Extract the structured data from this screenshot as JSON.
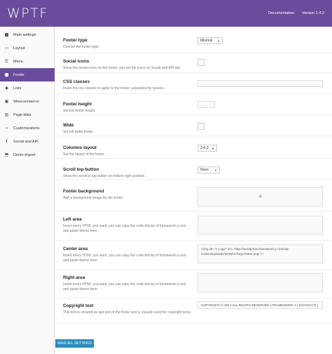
{
  "header": {
    "logo": "WPTF",
    "documentation": "Documentation",
    "version": "Version 1.4.2"
  },
  "sidebar": {
    "items": [
      {
        "label": "Main settings",
        "icon": "page-icon"
      },
      {
        "label": "Layout",
        "icon": "layout-icon"
      },
      {
        "label": "Menu",
        "icon": "menu-icon"
      },
      {
        "label": "Footer",
        "icon": "footer-icon",
        "active": true
      },
      {
        "label": "Lists",
        "icon": "tag-icon"
      },
      {
        "label": "Woocommerce",
        "icon": "cart-icon"
      },
      {
        "label": "Page titles",
        "icon": "titles-icon"
      },
      {
        "label": "Customizations",
        "icon": "code-icon"
      },
      {
        "label": "Social and API",
        "icon": "facebook-icon"
      },
      {
        "label": "Demo import",
        "icon": "import-icon"
      }
    ]
  },
  "settings": {
    "footer_type": {
      "label": "Footer type",
      "desc": "Choose the footer type.",
      "value": "Minimal"
    },
    "social_icons": {
      "label": "Social icons",
      "desc": "Show the social icons on the footer, you set the icons on Social and API tab."
    },
    "css_classes": {
      "label": "CSS classes",
      "desc": "Insert the css classes to apply to the footer, separated by spaces."
    },
    "footer_height": {
      "label": "Footer height",
      "desc": "Set the footer height."
    },
    "wide": {
      "label": "Wide",
      "desc": "Set full width footer."
    },
    "columns_layout": {
      "label": "Columns layout",
      "desc": "Set the layout of the footer.",
      "value": "3-6-3"
    },
    "scroll_top": {
      "label": "Scroll top button",
      "desc": "Show the scroll to top button on bottom right position.",
      "value": "None"
    },
    "footer_background": {
      "label": "Footer background",
      "desc": "Add a background image for the footer.",
      "plus": "+"
    },
    "left_area": {
      "label": "Left area",
      "desc": "Insert every HTML you want, you can copy the code blocks of framework-y.com and paste theme here."
    },
    "center_area": {
      "label": "Center area",
      "desc": "Insert every HTML you want, you can copy the code blocks of framework-y.com and paste theme here.",
      "value": "<img alt=\"Y Logo\" src=\"http://wordpress.framework-y.com/wp-content/uploads/2016/07/logo-footer.png\" />"
    },
    "right_area": {
      "label": "Right area",
      "desc": "Insert every HTML you want, you can copy the code blocks of framework-y.com and paste theme here."
    },
    "copyright": {
      "label": "Copyright text",
      "desc": "This text is showed as last text of the footer and is visually used for copyright texts.",
      "value": "COPYRIGHT © 2017 ALL RIGHTS RESERVED | FRAMEWORK Y | SCHIOCCO |"
    }
  },
  "actions": {
    "save": "SAVE ALL SETTINGS"
  },
  "colors": {
    "brand": "#6a4c9c",
    "save_button": "#2e8bbf"
  }
}
